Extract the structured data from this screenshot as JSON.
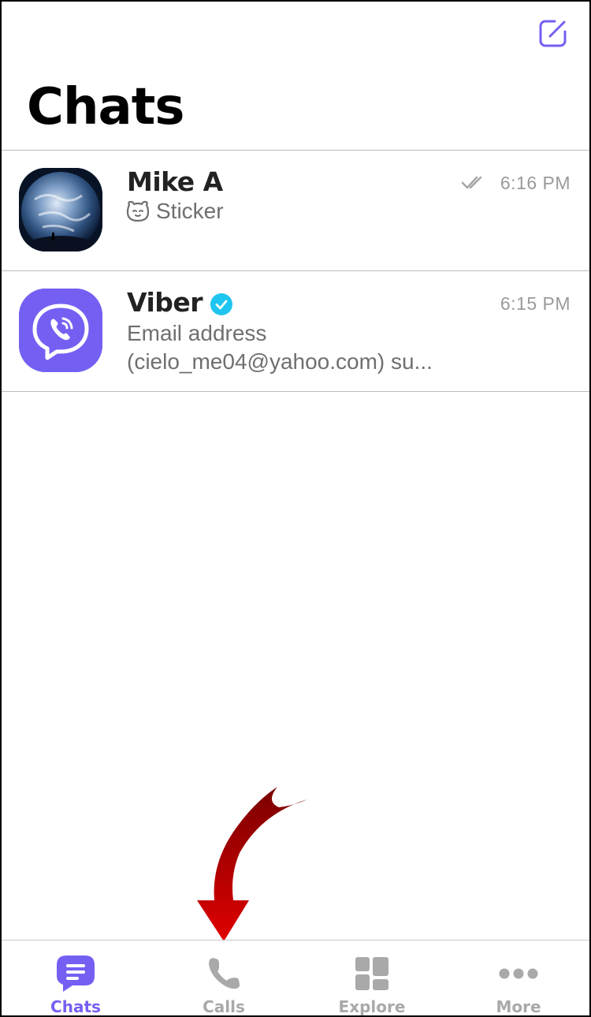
{
  "header": {
    "title": "Chats",
    "compose_icon": "compose-icon"
  },
  "chats": [
    {
      "name": "Mike A",
      "time": "6:16 PM",
      "status_icon": "double-check-icon",
      "preview_icon": "sticker-icon",
      "preview": "Sticker"
    },
    {
      "name": "Viber",
      "time": "6:15 PM",
      "verified_icon": "verified-badge-icon",
      "preview_line1": "Email address",
      "preview_line2": "(cielo_me04@yahoo.com) su..."
    }
  ],
  "bottom_nav": {
    "items": [
      {
        "label": "Chats",
        "icon": "chat-bubble-icon",
        "active": true
      },
      {
        "label": "Calls",
        "icon": "phone-icon",
        "active": false
      },
      {
        "label": "Explore",
        "icon": "explore-grid-icon",
        "active": false
      },
      {
        "label": "More",
        "icon": "more-dots-icon",
        "active": false
      }
    ]
  },
  "colors": {
    "accent": "#7360f2",
    "inactive": "#a9a9a9",
    "verified": "#1ec5f0",
    "annotation_arrow": "#c00000"
  }
}
